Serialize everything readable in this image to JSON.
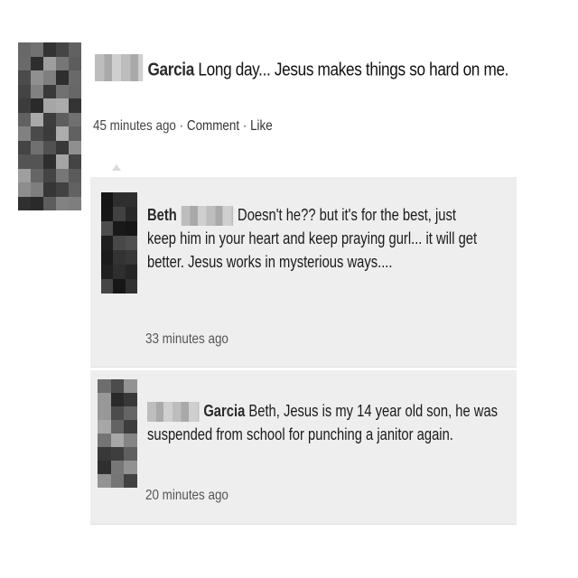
{
  "post": {
    "author_surname": "Garcia",
    "text": "Long day... Jesus makes things so hard on me.",
    "timestamp": "45 minutes ago",
    "separator": "·",
    "comment_label": "Comment",
    "like_label": "Like"
  },
  "comments": [
    {
      "author_first": "Beth",
      "line1": "Doesn't he?? but it's for the best, just",
      "line2": "keep him in your heart and keep praying gurl... it will get",
      "line3": "better. Jesus works in mysterious ways....",
      "timestamp": "33 minutes ago"
    },
    {
      "author_surname": "Garcia",
      "line1": "Beth, Jesus is my 14 year old son, he was",
      "line2": "suspended from school for punching a janitor again.",
      "timestamp": "20 minutes ago"
    }
  ]
}
